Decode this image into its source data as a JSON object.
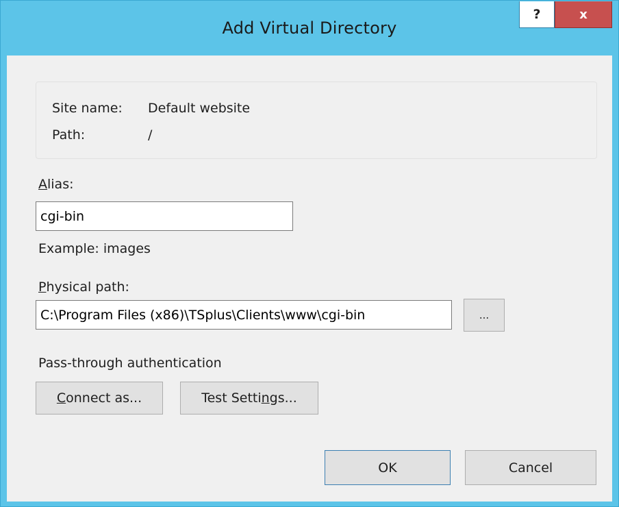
{
  "window": {
    "title": "Add Virtual Directory",
    "help_label": "?",
    "close_label": "x"
  },
  "site_info": {
    "site_name_label": "Site name:",
    "site_name_value": "Default website",
    "path_label": "Path:",
    "path_value": "/"
  },
  "alias": {
    "label_access_key": "A",
    "label_rest": "lias:",
    "value": "cgi-bin",
    "example": "Example: images"
  },
  "physical_path": {
    "label_access_key": "P",
    "label_rest": "hysical path:",
    "value": "C:\\Program Files (x86)\\TSplus\\Clients\\www\\cgi-bin",
    "browse_label": "..."
  },
  "authentication": {
    "heading": "Pass-through authentication",
    "connect_as_access_key": "C",
    "connect_as_rest": "onnect as...",
    "test_settings_before": "Test Setti",
    "test_settings_access_key": "n",
    "test_settings_after": "gs..."
  },
  "footer": {
    "ok_label": "OK",
    "cancel_label": "Cancel"
  }
}
